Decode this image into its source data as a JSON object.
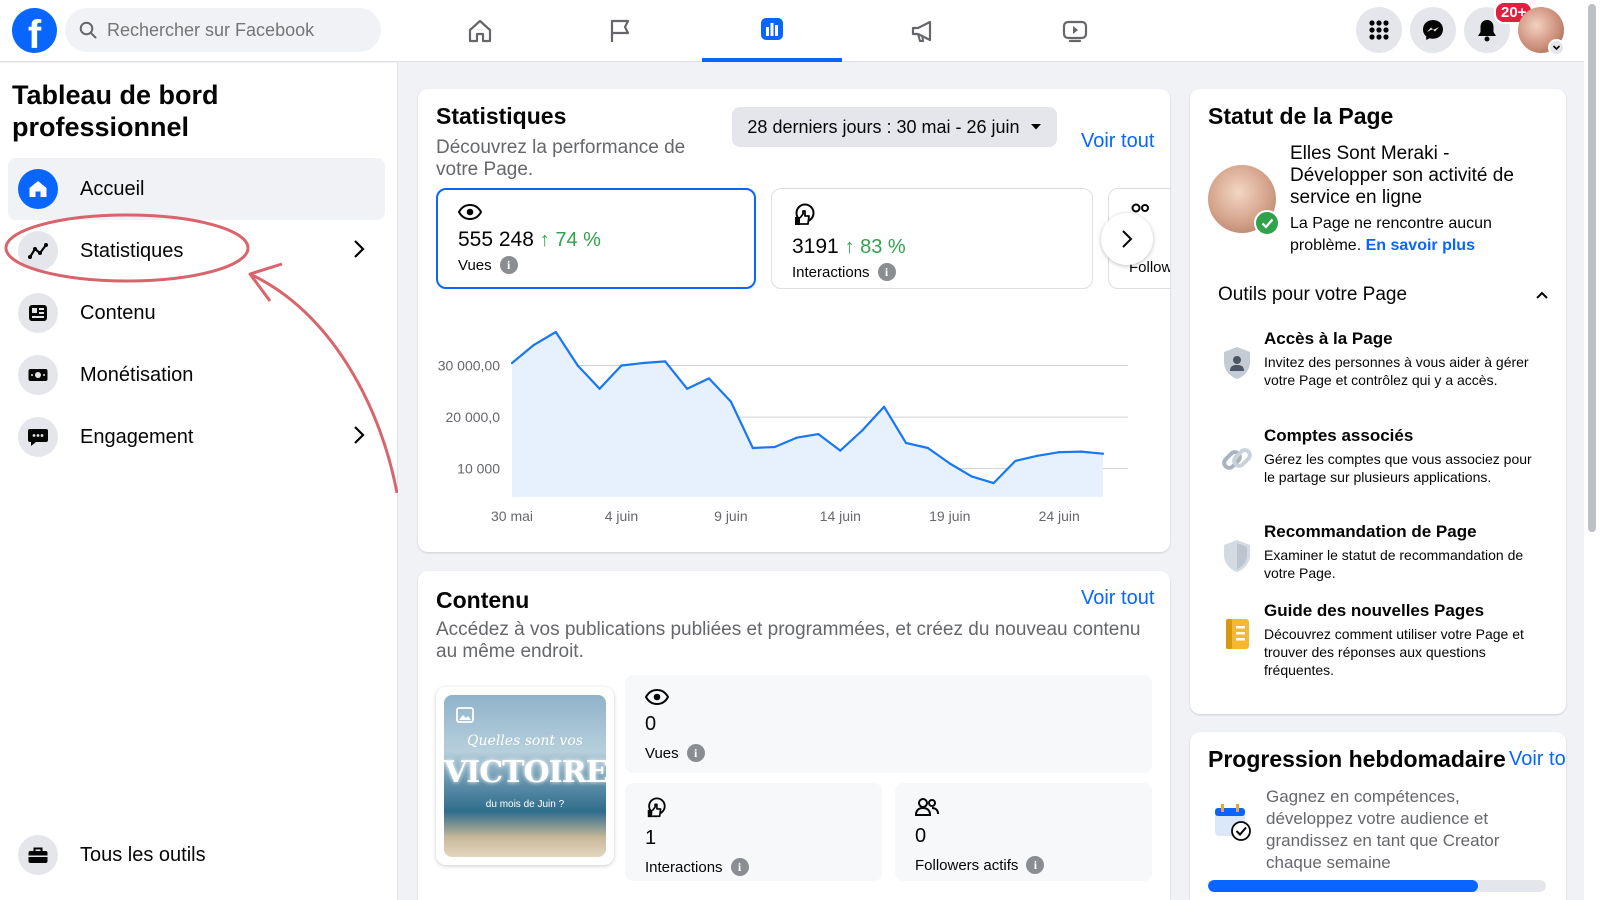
{
  "topbar": {
    "logo": "f",
    "search_placeholder": "Rechercher sur Facebook",
    "nav_icons": [
      "home-icon",
      "flag-icon",
      "insights-icon",
      "megaphone-icon",
      "video-icon"
    ],
    "active_nav": "insights-icon",
    "notifications_badge": "20+"
  },
  "sidebar": {
    "title": "Tableau de bord professionnel",
    "items": [
      {
        "label": "Accueil",
        "icon": "home-icon",
        "active": true
      },
      {
        "label": "Statistiques",
        "icon": "trend-icon",
        "chevron": true
      },
      {
        "label": "Contenu",
        "icon": "content-icon"
      },
      {
        "label": "Monétisation",
        "icon": "money-icon"
      },
      {
        "label": "Engagement",
        "icon": "chat-icon",
        "chevron": true
      }
    ],
    "footer_item": {
      "label": "Tous les outils",
      "icon": "toolbox-icon"
    }
  },
  "stats": {
    "title": "Statistiques",
    "subtitle": "Découvrez la performance de votre Page.",
    "date_range": "28 derniers jours : 30 mai - 26 juin",
    "voir_tout": "Voir tout",
    "metrics": [
      {
        "value": "555 248",
        "change": "74 %",
        "label": "Vues",
        "icon": "eye-icon"
      },
      {
        "value": "3191",
        "change": "83 %",
        "label": "Interactions",
        "icon": "interactions-icon"
      },
      {
        "label": "Followers",
        "icon": "followers-icon"
      }
    ]
  },
  "chart_data": {
    "type": "area",
    "x": [
      "30 mai",
      "31 mai",
      "1 juin",
      "2 juin",
      "3 juin",
      "4 juin",
      "5 juin",
      "6 juin",
      "7 juin",
      "8 juin",
      "9 juin",
      "10 juin",
      "11 juin",
      "12 juin",
      "13 juin",
      "14 juin",
      "15 juin",
      "16 juin",
      "17 juin",
      "18 juin",
      "19 juin",
      "20 juin",
      "21 juin",
      "22 juin",
      "23 juin",
      "24 juin",
      "25 juin",
      "26 juin"
    ],
    "values": [
      30500,
      34000,
      36500,
      30000,
      25500,
      30000,
      30500,
      30800,
      25500,
      27500,
      23000,
      14000,
      14200,
      16000,
      16700,
      13500,
      17400,
      22000,
      15000,
      14000,
      11000,
      8500,
      7200,
      11500,
      12500,
      13200,
      13300,
      12900
    ],
    "xticks": [
      "30 mai",
      "4 juin",
      "9 juin",
      "14 juin",
      "19 juin",
      "24 juin"
    ],
    "yticks": [
      "30 000,00",
      "20 000,0",
      "10 000"
    ],
    "ytick_values": [
      30000,
      20000,
      10000
    ],
    "ylim": [
      4500,
      40000
    ],
    "grid": true,
    "color": "#1877f2",
    "fill": "#e7f0fd"
  },
  "content": {
    "title": "Contenu",
    "voir_tout": "Voir tout",
    "subtitle": "Accédez à vos publications publiées et programmées, et créez du nouveau contenu au même endroit.",
    "thumbnail": {
      "line1": "Quelles sont vos",
      "line2": "VICTOIRES",
      "line3": "du mois de Juin ?"
    },
    "stats": [
      {
        "value": "0",
        "label": "Vues",
        "icon": "eye-icon"
      },
      {
        "value": "1",
        "label": "Interactions",
        "icon": "interactions-icon"
      },
      {
        "value": "0",
        "label": "Followers actifs",
        "icon": "followers-icon"
      }
    ]
  },
  "page_status": {
    "title": "Statut de la Page",
    "page_name": "Elles Sont Meraki - Développer son activité de service en ligne",
    "status_text": "La Page ne rencontre aucun problème.",
    "learn_more": "En savoir plus",
    "tools_title": "Outils pour votre Page",
    "tools": [
      {
        "title": "Accès à la Page",
        "desc": "Invitez des personnes à vous aider à gérer votre Page et contrôlez qui y a accès.",
        "icon": "person-shield-icon"
      },
      {
        "title": "Comptes associés",
        "desc": "Gérez les comptes que vous associez pour le partage sur plusieurs applications.",
        "icon": "link-icon"
      },
      {
        "title": "Recommandation de Page",
        "desc": "Examiner le statut de recommandation de votre Page.",
        "icon": "shield-icon"
      },
      {
        "title": "Guide des nouvelles Pages",
        "desc": "Découvrez comment utiliser votre Page et trouver des réponses aux questions fréquentes.",
        "icon": "notebook-icon"
      }
    ]
  },
  "weekly": {
    "title": "Progression hebdomadaire",
    "voir_tout": "Voir tout",
    "desc": "Gagnez en compétences, développez votre audience et grandissez en tant que Creator chaque semaine",
    "progress": 0.8,
    "icon": "calendar-check-icon"
  },
  "colors": {
    "accent": "#0866ff",
    "positive": "#31a24c",
    "annotation": "#d9646b"
  }
}
